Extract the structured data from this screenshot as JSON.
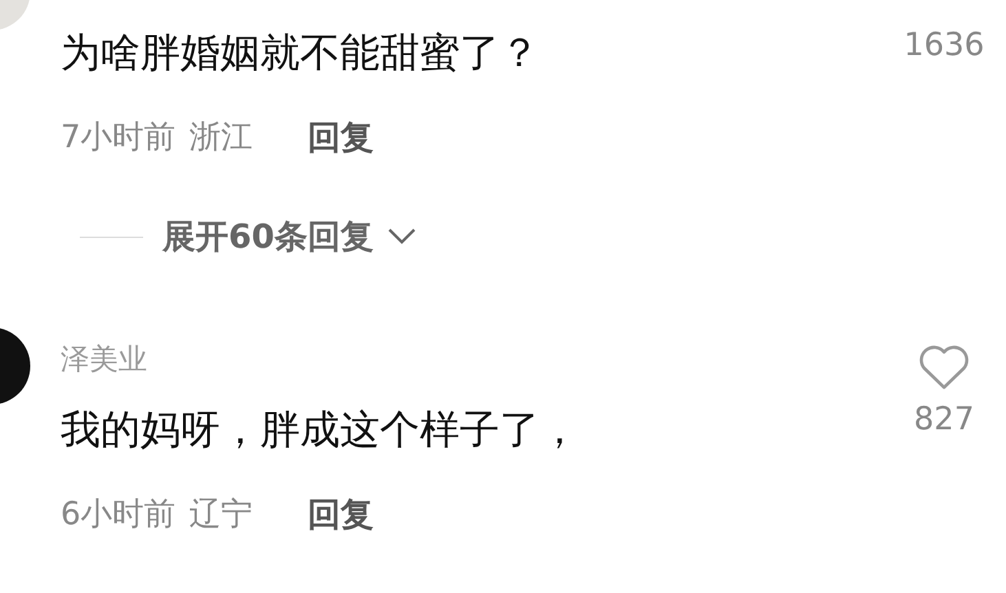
{
  "comments": [
    {
      "text": "为啥胖婚姻就不能甜蜜了？",
      "likes": "1636",
      "time": "7小时前",
      "location": "浙江",
      "reply": "回复",
      "expand": "展开60条回复"
    },
    {
      "username": "泽美业",
      "text": "我的妈呀，胖成这个样子了，",
      "likes": "827",
      "time": "6小时前",
      "location": "辽宁",
      "reply": "回复"
    }
  ]
}
